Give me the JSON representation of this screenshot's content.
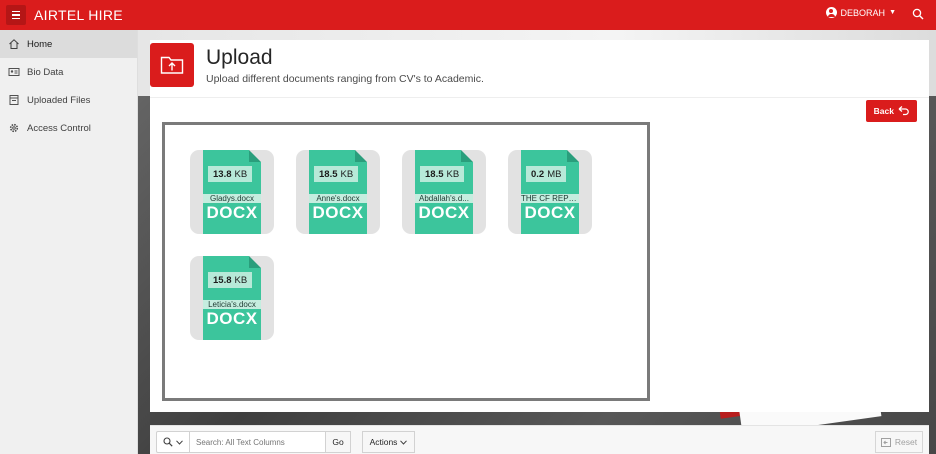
{
  "header": {
    "app_title": "AIRTEL HIRE",
    "user_name": "DEBORAH",
    "brand_color": "#da1c1c"
  },
  "sidebar": {
    "items": [
      {
        "label": "Home",
        "icon": "home-icon",
        "active": true
      },
      {
        "label": "Bio Data",
        "icon": "id-card-icon",
        "active": false
      },
      {
        "label": "Uploaded Files",
        "icon": "file-list-icon",
        "active": false
      },
      {
        "label": "Access Control",
        "icon": "gear-icon",
        "active": false
      }
    ]
  },
  "region": {
    "title": "Upload",
    "subtitle": "Upload different documents ranging from CV's to Academic.",
    "icon": "folder-upload-icon",
    "back_label": "Back"
  },
  "files": [
    {
      "size_value": "13.8",
      "size_unit": "KB",
      "name": "Gladys.docx",
      "ext": "DOCX"
    },
    {
      "size_value": "18.5",
      "size_unit": "KB",
      "name": "Anne's.docx",
      "ext": "DOCX"
    },
    {
      "size_value": "18.5",
      "size_unit": "KB",
      "name": "Abdallah's.d...",
      "ext": "DOCX"
    },
    {
      "size_value": "0.2",
      "size_unit": "MB",
      "name": "THE CF REPO...",
      "ext": "DOCX"
    },
    {
      "size_value": "15.8",
      "size_unit": "KB",
      "name": "Leticia's.docx",
      "ext": "DOCX"
    }
  ],
  "toolbar": {
    "search_placeholder": "Search: All Text Columns",
    "go_label": "Go",
    "actions_label": "Actions",
    "reset_label": "Reset"
  }
}
